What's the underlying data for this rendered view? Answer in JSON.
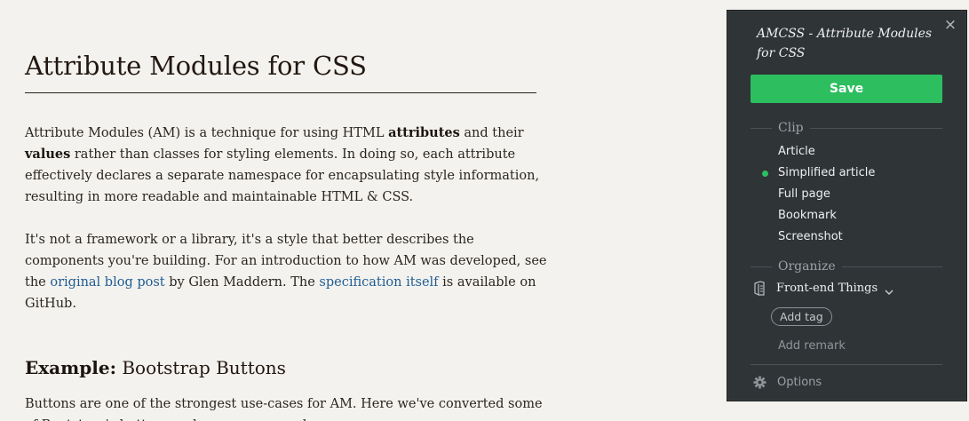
{
  "article": {
    "title": "Attribute Modules for CSS",
    "p1": {
      "t1": "Attribute Modules (AM) is a technique for using HTML ",
      "b1": "attributes",
      "t2": " and their ",
      "b2": "values",
      "t3": " rather than classes for styling elements. In doing so, each attribute effectively declares a separate namespace for encapsulating style information, resulting in more readable and maintainable HTML & CSS."
    },
    "p2": {
      "t1": "It's not a framework or a library, it's a style that better describes the components you're building. For an introduction to how AM was developed, see the ",
      "link1": "original blog post",
      "t2": " by Glen Maddern. The ",
      "link2": "specification itself",
      "t3": " is available on GitHub."
    },
    "example_heading": {
      "bold": "Example:",
      "rest": " Bootstrap Buttons"
    },
    "p3": "Buttons are one of the strongest use-cases for AM. Here we've converted some of Bootstrap's button markup as an example."
  },
  "clipper": {
    "close_icon": "close-icon",
    "title": "AMCSS - Attribute Modules for CSS",
    "save_label": "Save",
    "clip_heading": "Clip",
    "clip_options": [
      {
        "label": "Article",
        "selected": false
      },
      {
        "label": "Simplified article",
        "selected": true
      },
      {
        "label": "Full page",
        "selected": false
      },
      {
        "label": "Bookmark",
        "selected": false
      },
      {
        "label": "Screenshot",
        "selected": false
      }
    ],
    "organize_heading": "Organize",
    "notebook": "Front-end Things",
    "notebook_icon": "notebook-icon",
    "add_tag": "Add tag",
    "add_remark": "Add remark",
    "options_label": "Options",
    "options_icon": "gear-icon"
  },
  "colors": {
    "page_bg": "#f4f2ee",
    "panel_bg": "#2f3437",
    "accent_green": "#2dbe60",
    "link_blue": "#1c5c94"
  }
}
